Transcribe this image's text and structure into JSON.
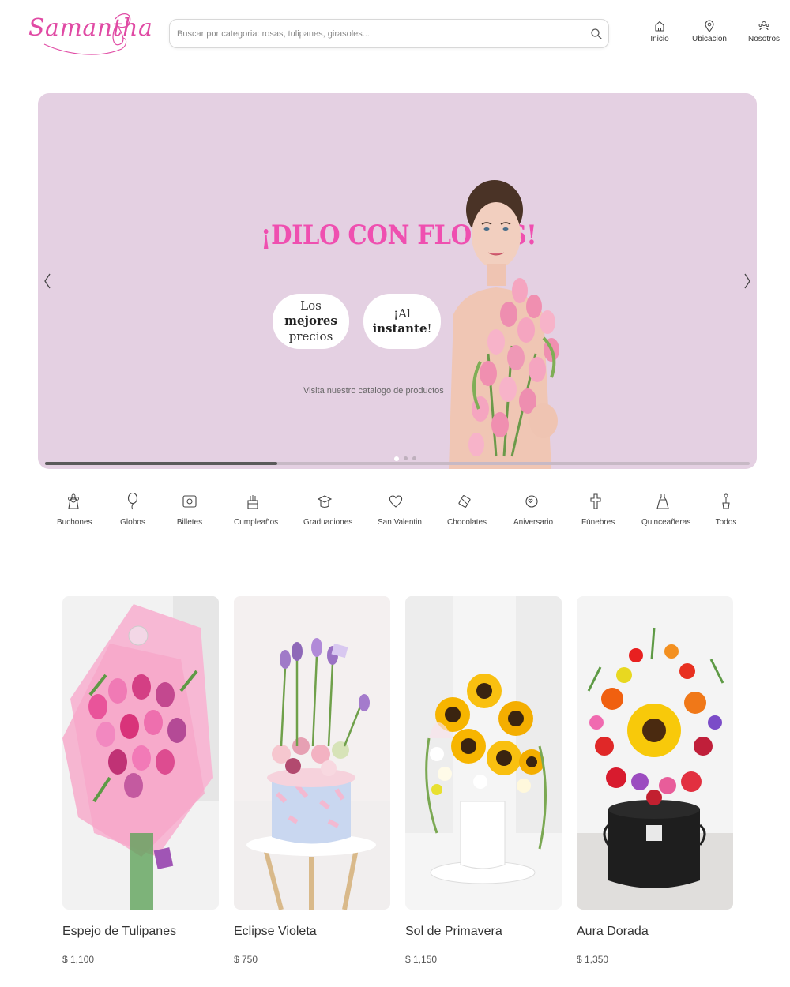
{
  "header": {
    "logo_text": "Samantha",
    "search": {
      "placeholder": "Buscar por categoria: rosas, tulipanes, girasoles..."
    },
    "nav": [
      {
        "label": "Inicio",
        "icon": "home-icon"
      },
      {
        "label": "Ubicacion",
        "icon": "location-pin-icon"
      },
      {
        "label": "Nosotros",
        "icon": "people-icon"
      }
    ]
  },
  "hero": {
    "title": "¡DILO CON FLORES!",
    "pill_1_line1_plain": "Los ",
    "pill_1_line1_bold": "mejores",
    "pill_1_line2": "precios",
    "pill_2_plain": "¡Al ",
    "pill_2_bold": "instante",
    "pill_2_end": "!",
    "subtitle": "Visita nuestro catalogo de productos",
    "slides_total": 3,
    "active_slide": 1,
    "progress_fraction": 0.33
  },
  "categories": [
    {
      "label": "Buchones",
      "icon": "flower-icon"
    },
    {
      "label": "Globos",
      "icon": "balloon-icon"
    },
    {
      "label": "Billetes",
      "icon": "banknote-icon"
    },
    {
      "label": "Cumpleaños",
      "icon": "cake-icon"
    },
    {
      "label": "Graduaciones",
      "icon": "graduation-cap-icon"
    },
    {
      "label": "San Valentin",
      "icon": "heart-icon"
    },
    {
      "label": "Chocolates",
      "icon": "candy-icon"
    },
    {
      "label": "Aniversario",
      "icon": "anniversary-icon"
    },
    {
      "label": "Fúnebres",
      "icon": "cross-icon"
    },
    {
      "label": "Quinceañeras",
      "icon": "dress-icon"
    },
    {
      "label": "Todos",
      "icon": "plant-pot-icon"
    }
  ],
  "products": [
    {
      "name": "Espejo de Tulipanes",
      "price": "$ 1,100"
    },
    {
      "name": "Eclipse Violeta",
      "price": "$ 750"
    },
    {
      "name": "Sol de Primavera",
      "price": "$ 1,150"
    },
    {
      "name": "Aura Dorada",
      "price": "$ 1,350"
    }
  ],
  "colors": {
    "brand_pink": "#ef4fb0",
    "hero_background": "#e4d0e2",
    "text_dark": "#333333"
  }
}
